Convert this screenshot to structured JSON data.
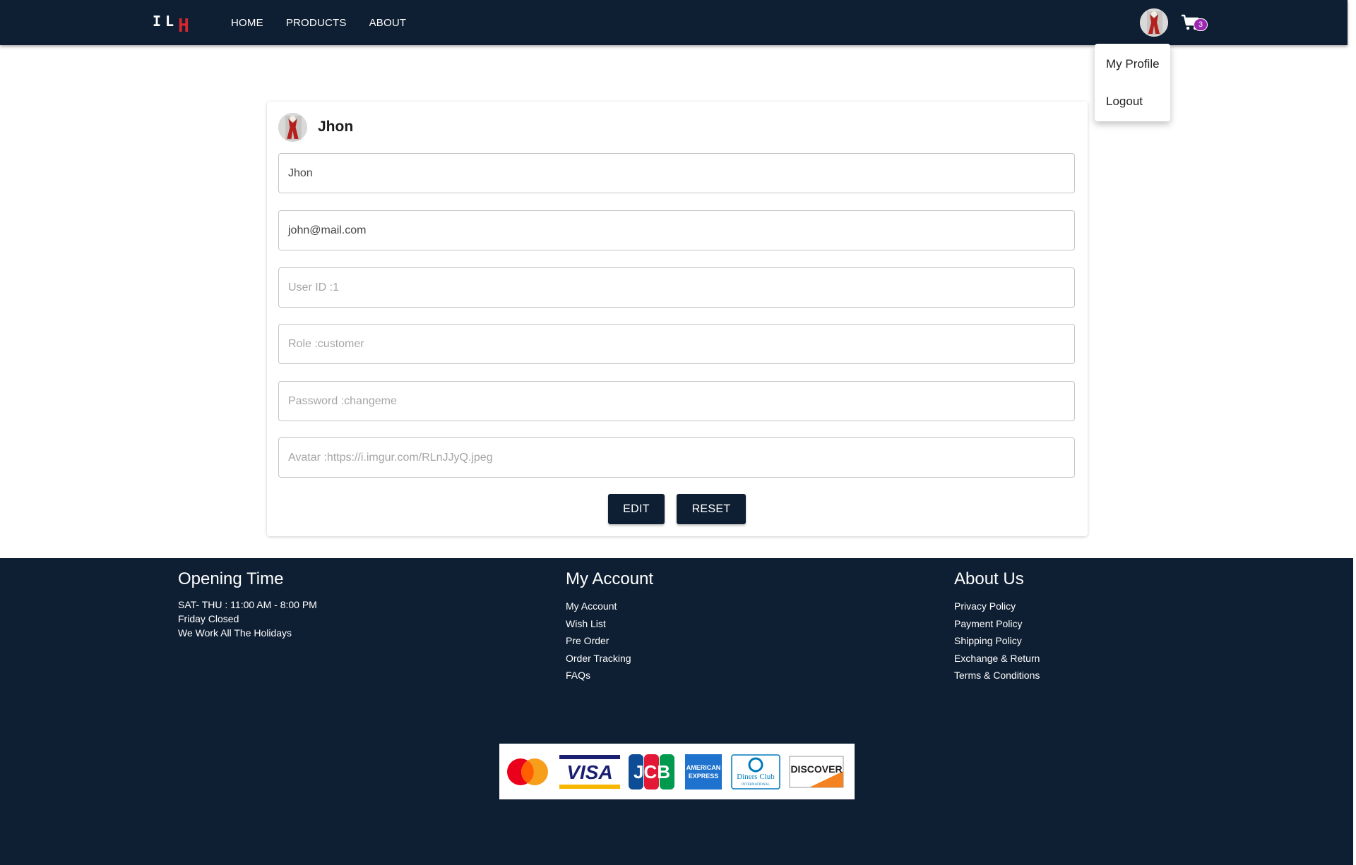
{
  "navbar": {
    "logo_left": "IL",
    "logo_right": "H",
    "links": [
      {
        "label": "HOME"
      },
      {
        "label": "PRODUCTS"
      },
      {
        "label": "ABOUT"
      }
    ],
    "cart_count": "3"
  },
  "dropdown": {
    "items": [
      {
        "label": "My Profile"
      },
      {
        "label": "Logout"
      }
    ]
  },
  "profile": {
    "name": "Jhon",
    "fields": [
      {
        "name": "name-field",
        "value": "Jhon",
        "placeholder": ""
      },
      {
        "name": "email-field",
        "value": "john@mail.com",
        "placeholder": ""
      },
      {
        "name": "user-id-field",
        "value": "",
        "placeholder": "User ID :1"
      },
      {
        "name": "role-field",
        "value": "",
        "placeholder": "Role :customer"
      },
      {
        "name": "password-field",
        "value": "",
        "placeholder": "Password :changeme"
      },
      {
        "name": "avatar-field",
        "value": "",
        "placeholder": "Avatar :https://i.imgur.com/RLnJJyQ.jpeg"
      }
    ],
    "edit_label": "EDIT",
    "reset_label": "RESET"
  },
  "footer": {
    "opening": {
      "title": "Opening Time",
      "lines": [
        "SAT- THU : 11:00 AM - 8:00 PM",
        "Friday Closed",
        "We Work All The Holidays"
      ]
    },
    "account": {
      "title": "My Account",
      "links": [
        "My Account",
        "Wish List",
        "Pre Order",
        "Order Tracking",
        "FAQs"
      ]
    },
    "about": {
      "title": "About Us",
      "links": [
        "Privacy Policy",
        "Payment Policy",
        "Shipping Policy",
        "Exchange & Return",
        "Terms & Conditions"
      ]
    },
    "payments": [
      "mastercard",
      "VISA",
      "JCB",
      "AMERICAN EXPRESS",
      "Diners Club INTERNATIONAL",
      "DISCOVER"
    ]
  },
  "colors": {
    "navy": "#0f1f33",
    "badge": "#9c27b0",
    "logo_accent": "#d7262f"
  }
}
